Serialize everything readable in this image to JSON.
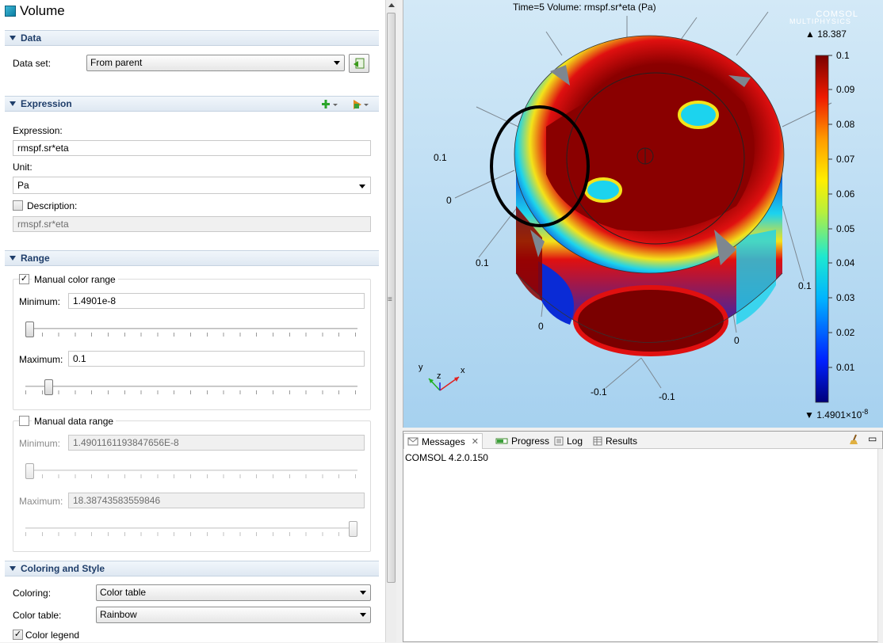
{
  "panel": {
    "title": "Volume",
    "data_section": {
      "header": "Data",
      "dataset_label": "Data set:",
      "dataset_value": "From parent"
    },
    "expression_section": {
      "header": "Expression",
      "expression_label": "Expression:",
      "expression_value": "rmspf.sr*eta",
      "unit_label": "Unit:",
      "unit_value": "Pa",
      "description_label": "Description:",
      "description_checked": false,
      "description_value": "rmspf.sr*eta"
    },
    "range_section": {
      "header": "Range",
      "manual_color_range_label": "Manual color range",
      "manual_color_range_checked": true,
      "color_minimum_label": "Minimum:",
      "color_minimum_value": "1.4901e-8",
      "color_maximum_label": "Maximum:",
      "color_maximum_value": "0.1",
      "manual_data_range_label": "Manual data range",
      "manual_data_range_checked": false,
      "data_minimum_label": "Minimum:",
      "data_minimum_value": "1.4901161193847656E-8",
      "data_maximum_label": "Maximum:",
      "data_maximum_value": "18.38743583559846"
    },
    "coloring_section": {
      "header": "Coloring and Style",
      "coloring_label": "Coloring:",
      "coloring_value": "Color table",
      "color_table_label": "Color table:",
      "color_table_value": "Rainbow",
      "color_legend_label": "Color legend",
      "color_legend_checked": true
    }
  },
  "graphics": {
    "plot_title": "Time=5  Volume: rmspf.sr*eta (Pa)",
    "logo_line1": "COMSOL",
    "logo_line2": "MULTIPHYSICS",
    "max_marker": "▲ 18.387",
    "min_marker": "▼ 1.4901×10",
    "min_marker_exp": "-8",
    "legend_ticks": [
      "0.1",
      "0.09",
      "0.08",
      "0.07",
      "0.06",
      "0.05",
      "0.04",
      "0.03",
      "0.02",
      "0.01"
    ],
    "axis_labels": [
      "0.1",
      "0",
      "0.1",
      "0",
      "0",
      "0.1",
      "-0.1",
      "-0.1"
    ],
    "triad": {
      "x": "x",
      "y": "y",
      "z": "z"
    },
    "colors": {
      "dark_red": "#7a0000",
      "red": "#e01010",
      "blue": "#0a2bd6",
      "cyan": "#1cd3ee",
      "yellow": "#f3e31a"
    }
  },
  "messages": {
    "tabs": [
      "Messages",
      "Progress",
      "Log",
      "Results"
    ],
    "content": "COMSOL 4.2.0.150"
  }
}
